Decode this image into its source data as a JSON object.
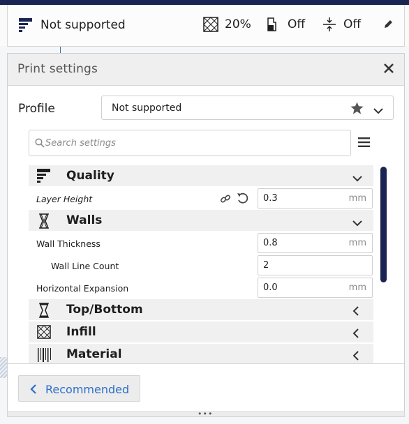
{
  "header": {
    "profile_label": "Not supported",
    "infill_value": "20%",
    "support_value": "Off",
    "adhesion_value": "Off"
  },
  "panel": {
    "title": "Print settings",
    "profile_label": "Profile",
    "profile_value": "Not supported",
    "search_placeholder": "Search settings"
  },
  "categories": {
    "quality": "Quality",
    "walls": "Walls",
    "top_bottom": "Top/Bottom",
    "infill": "Infill",
    "material": "Material"
  },
  "settings": {
    "layer_height": {
      "label": "Layer Height",
      "value": "0.3",
      "unit": "mm"
    },
    "wall_thickness": {
      "label": "Wall Thickness",
      "value": "0.8",
      "unit": "mm"
    },
    "wall_line_count": {
      "label": "Wall Line Count",
      "value": "2"
    },
    "horizontal_expansion": {
      "label": "Horizontal Expansion",
      "value": "0.0",
      "unit": "mm"
    }
  },
  "footer": {
    "recommended_label": "Recommended",
    "grip_dots": "•••"
  },
  "colors": {
    "accent": "#1b2553",
    "link": "#2d6ec8"
  },
  "icons": [
    "quality-icon",
    "infill-icon",
    "support-icon",
    "adhesion-icon",
    "pencil-icon",
    "close-icon",
    "star-icon",
    "chevron-down-icon",
    "search-icon",
    "menu-icon",
    "link-icon",
    "reset-icon",
    "walls-icon",
    "top-bottom-icon",
    "material-icon",
    "chevron-left-icon"
  ]
}
